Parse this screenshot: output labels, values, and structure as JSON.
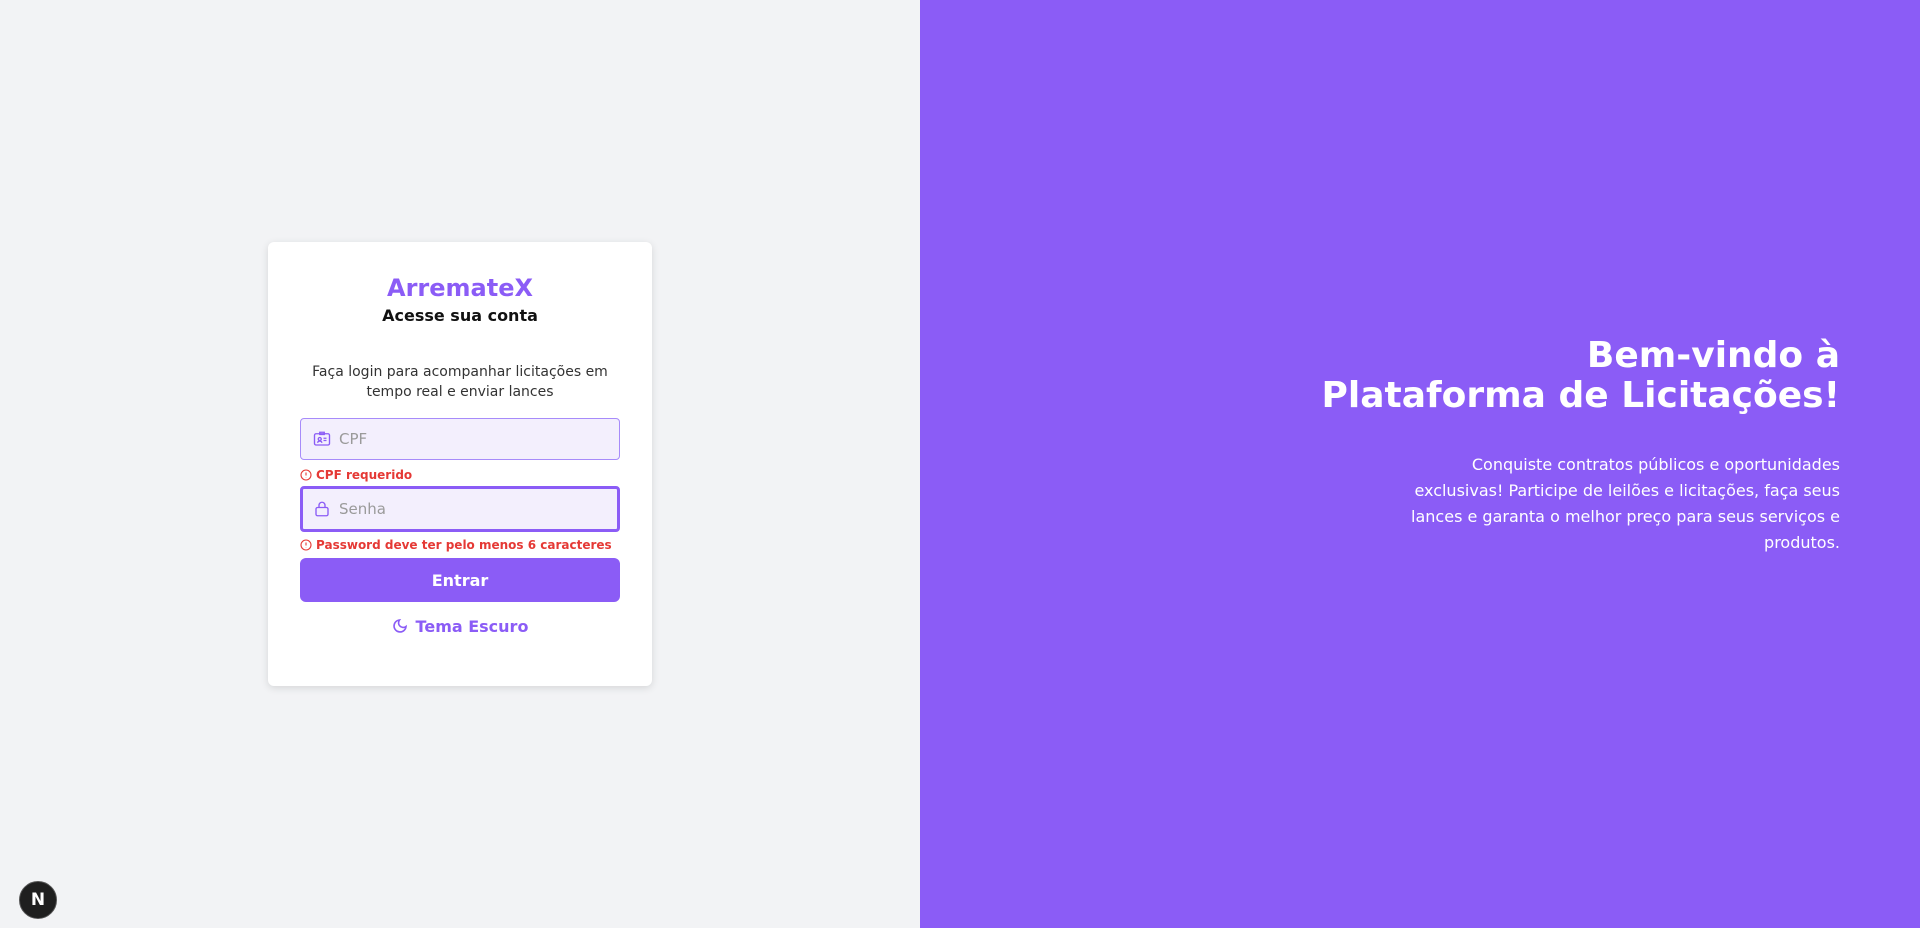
{
  "login": {
    "brand": "ArremateX",
    "subtitle": "Acesse sua conta",
    "description": "Faça login para acompanhar licitações em tempo real e enviar lances",
    "cpf": {
      "placeholder": "CPF",
      "value": "",
      "icon": "id-card-icon",
      "error": "CPF requerido"
    },
    "password": {
      "placeholder": "Senha",
      "value": "",
      "icon": "lock-icon",
      "error": "Password deve ter pelo menos 6 caracteres"
    },
    "submit_label": "Entrar",
    "theme_toggle": {
      "label": "Tema Escuro",
      "icon": "moon-icon"
    }
  },
  "hero": {
    "title_line1": "Bem-vindo à",
    "title_line2": "Plataforma de Licitações!",
    "text": "Conquiste contratos públicos e oportunidades exclusivas! Participe de leilões e licitações, faça seus lances e garanta o melhor preço para seus serviços e produtos."
  },
  "dev_badge": {
    "label": "N"
  },
  "colors": {
    "accent": "#8b5cf6",
    "error": "#e53935",
    "left_background": "#f2f3f5"
  }
}
